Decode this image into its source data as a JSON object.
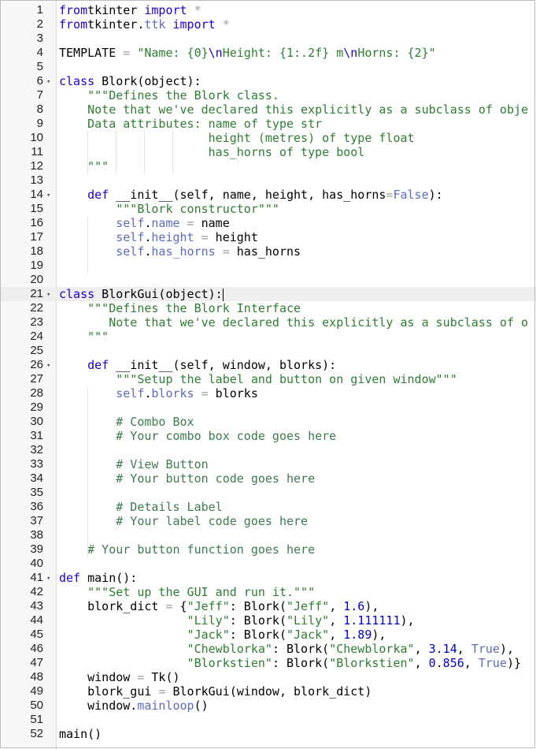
{
  "editor": {
    "language": "python",
    "active_line": 21,
    "cursor": {
      "line": 21,
      "after_text": "class BlorkGui(object):"
    },
    "colors": {
      "keyword": "#1c00cf",
      "string": "#2e7d32",
      "comment": "#3d7a4d",
      "number": "#0000cc",
      "property": "#5c6bc0",
      "operator": "#9e9e9e",
      "gutter_bg": "#f7f7f7",
      "active_line_bg": "#eeeeee"
    },
    "lines": [
      {
        "n": "1",
        "fold": false,
        "segs": [
          [
            "kw",
            "from"
          ],
          [
            "",
            "tkinter "
          ],
          [
            "kw",
            "import"
          ],
          [
            "op",
            " *"
          ]
        ]
      },
      {
        "n": "2",
        "fold": false,
        "segs": [
          [
            "kw",
            "from"
          ],
          [
            "",
            "tkinter."
          ],
          [
            "prop",
            "ttk"
          ],
          [
            "kw",
            " import"
          ],
          [
            "op",
            " *"
          ]
        ]
      },
      {
        "n": "3",
        "fold": false,
        "segs": []
      },
      {
        "n": "4",
        "fold": false,
        "segs": [
          [
            "",
            "TEMPLATE "
          ],
          [
            "op",
            "="
          ],
          [
            "str",
            " \"Name: {0}"
          ],
          [
            "kw",
            "\\n"
          ],
          [
            "str",
            "Height: {1:.2f} m"
          ],
          [
            "kw",
            "\\n"
          ],
          [
            "str",
            "Horns: {2}\""
          ]
        ]
      },
      {
        "n": "5",
        "fold": false,
        "segs": []
      },
      {
        "n": "6",
        "fold": true,
        "segs": [
          [
            "kw",
            "class"
          ],
          [
            "",
            " Blork(object):"
          ]
        ]
      },
      {
        "n": "7",
        "fold": false,
        "segs": [
          [
            "str",
            "    \"\"\"Defines the Blork class."
          ]
        ]
      },
      {
        "n": "8",
        "fold": false,
        "segs": [
          [
            "str",
            "    Note that we've declared this explicitly as a subclass of obje"
          ]
        ]
      },
      {
        "n": "9",
        "fold": false,
        "segs": [
          [
            "str",
            "    Data attributes: name of type str"
          ]
        ]
      },
      {
        "n": "10",
        "fold": false,
        "segs": [
          [
            "str",
            "                     height (metres) of type float"
          ]
        ]
      },
      {
        "n": "11",
        "fold": false,
        "segs": [
          [
            "str",
            "                     has_horns of type bool"
          ]
        ]
      },
      {
        "n": "12",
        "fold": false,
        "segs": [
          [
            "str",
            "    \"\"\""
          ]
        ]
      },
      {
        "n": "13",
        "fold": false,
        "segs": []
      },
      {
        "n": "14",
        "fold": true,
        "segs": [
          [
            "kw",
            "    def"
          ],
          [
            "",
            " __init__(self, name, height, has_horns"
          ],
          [
            "op",
            "="
          ],
          [
            "prop",
            "False"
          ],
          [
            "",
            "):"
          ]
        ]
      },
      {
        "n": "15",
        "fold": false,
        "segs": [
          [
            "str",
            "        \"\"\"Blork constructor\"\"\""
          ]
        ]
      },
      {
        "n": "16",
        "fold": false,
        "segs": [
          [
            "prop",
            "        self"
          ],
          [
            "",
            "."
          ],
          [
            "prop",
            "name"
          ],
          [
            "op",
            " ="
          ],
          [
            "",
            " name"
          ]
        ]
      },
      {
        "n": "17",
        "fold": false,
        "segs": [
          [
            "prop",
            "        self"
          ],
          [
            "",
            "."
          ],
          [
            "prop",
            "height"
          ],
          [
            "op",
            " ="
          ],
          [
            "",
            " height"
          ]
        ]
      },
      {
        "n": "18",
        "fold": false,
        "segs": [
          [
            "prop",
            "        self"
          ],
          [
            "",
            "."
          ],
          [
            "prop",
            "has_horns"
          ],
          [
            "op",
            " ="
          ],
          [
            "",
            " has_horns"
          ]
        ]
      },
      {
        "n": "19",
        "fold": false,
        "segs": []
      },
      {
        "n": "20",
        "fold": false,
        "segs": []
      },
      {
        "n": "21",
        "fold": true,
        "segs": [
          [
            "kw",
            "class"
          ],
          [
            "",
            " BlorkGui(object):"
          ]
        ]
      },
      {
        "n": "22",
        "fold": false,
        "segs": [
          [
            "str",
            "    \"\"\"Defines the Blork Interface"
          ]
        ]
      },
      {
        "n": "23",
        "fold": false,
        "segs": [
          [
            "str",
            "       Note that we've declared this explicitly as a subclass of o"
          ]
        ]
      },
      {
        "n": "24",
        "fold": false,
        "segs": [
          [
            "str",
            "    \"\"\""
          ]
        ]
      },
      {
        "n": "25",
        "fold": false,
        "segs": []
      },
      {
        "n": "26",
        "fold": true,
        "segs": [
          [
            "kw",
            "    def"
          ],
          [
            "",
            " __init__(self, window, blorks):"
          ]
        ]
      },
      {
        "n": "27",
        "fold": false,
        "segs": [
          [
            "str",
            "        \"\"\"Setup the label and button on given window\"\"\""
          ]
        ]
      },
      {
        "n": "28",
        "fold": false,
        "segs": [
          [
            "prop",
            "        self"
          ],
          [
            "",
            "."
          ],
          [
            "prop",
            "blorks"
          ],
          [
            "op",
            " ="
          ],
          [
            "",
            " blorks"
          ]
        ]
      },
      {
        "n": "29",
        "fold": false,
        "segs": []
      },
      {
        "n": "30",
        "fold": false,
        "segs": [
          [
            "cmt",
            "        # Combo Box"
          ]
        ]
      },
      {
        "n": "31",
        "fold": false,
        "segs": [
          [
            "cmt",
            "        # Your combo box code goes here"
          ]
        ]
      },
      {
        "n": "32",
        "fold": false,
        "segs": []
      },
      {
        "n": "33",
        "fold": false,
        "segs": [
          [
            "cmt",
            "        # View Button"
          ]
        ]
      },
      {
        "n": "34",
        "fold": false,
        "segs": [
          [
            "cmt",
            "        # Your button code goes here"
          ]
        ]
      },
      {
        "n": "35",
        "fold": false,
        "segs": []
      },
      {
        "n": "36",
        "fold": false,
        "segs": [
          [
            "cmt",
            "        # Details Label"
          ]
        ]
      },
      {
        "n": "37",
        "fold": false,
        "segs": [
          [
            "cmt",
            "        # Your label code goes here"
          ]
        ]
      },
      {
        "n": "38",
        "fold": false,
        "segs": []
      },
      {
        "n": "39",
        "fold": false,
        "segs": [
          [
            "cmt",
            "    # Your button function goes here"
          ]
        ]
      },
      {
        "n": "40",
        "fold": false,
        "segs": []
      },
      {
        "n": "41",
        "fold": true,
        "segs": [
          [
            "kw",
            "def"
          ],
          [
            "",
            " main():"
          ]
        ]
      },
      {
        "n": "42",
        "fold": false,
        "segs": [
          [
            "str",
            "    \"\"\"Set up the GUI and run it.\"\"\""
          ]
        ]
      },
      {
        "n": "43",
        "fold": false,
        "segs": [
          [
            "",
            "    blork_dict "
          ],
          [
            "op",
            "="
          ],
          [
            "",
            " {"
          ],
          [
            "str",
            "\"Jeff\""
          ],
          [
            "",
            ": Blork("
          ],
          [
            "str",
            "\"Jeff\""
          ],
          [
            "",
            ", "
          ],
          [
            "num",
            "1.6"
          ],
          [
            "",
            "),"
          ]
        ]
      },
      {
        "n": "44",
        "fold": false,
        "segs": [
          [
            "str",
            "                  \"Lily\""
          ],
          [
            "",
            ": Blork("
          ],
          [
            "str",
            "\"Lily\""
          ],
          [
            "",
            ", "
          ],
          [
            "num",
            "1.111111"
          ],
          [
            "",
            "),"
          ]
        ]
      },
      {
        "n": "45",
        "fold": false,
        "segs": [
          [
            "str",
            "                  \"Jack\""
          ],
          [
            "",
            ": Blork("
          ],
          [
            "str",
            "\"Jack\""
          ],
          [
            "",
            ", "
          ],
          [
            "num",
            "1.89"
          ],
          [
            "",
            "),"
          ]
        ]
      },
      {
        "n": "46",
        "fold": false,
        "segs": [
          [
            "str",
            "                  \"Chewblorka\""
          ],
          [
            "",
            ": Blork("
          ],
          [
            "str",
            "\"Chewblorka\""
          ],
          [
            "",
            ", "
          ],
          [
            "num",
            "3.14"
          ],
          [
            "",
            ", "
          ],
          [
            "prop",
            "True"
          ],
          [
            "",
            "),"
          ]
        ]
      },
      {
        "n": "47",
        "fold": false,
        "segs": [
          [
            "str",
            "                  \"Blorkstien\""
          ],
          [
            "",
            ": Blork("
          ],
          [
            "str",
            "\"Blorkstien\""
          ],
          [
            "",
            ", "
          ],
          [
            "num",
            "0.856"
          ],
          [
            "",
            ", "
          ],
          [
            "prop",
            "True"
          ],
          [
            "",
            ")}"
          ]
        ]
      },
      {
        "n": "48",
        "fold": false,
        "segs": [
          [
            "",
            "    window "
          ],
          [
            "op",
            "="
          ],
          [
            "",
            " Tk()"
          ]
        ]
      },
      {
        "n": "49",
        "fold": false,
        "segs": [
          [
            "",
            "    blork_gui "
          ],
          [
            "op",
            "="
          ],
          [
            "",
            " BlorkGui(window, blork_dict)"
          ]
        ]
      },
      {
        "n": "50",
        "fold": false,
        "segs": [
          [
            "",
            "    window."
          ],
          [
            "prop",
            "mainloop"
          ],
          [
            "",
            "()"
          ]
        ]
      },
      {
        "n": "51",
        "fold": false,
        "segs": []
      },
      {
        "n": "52",
        "fold": false,
        "segs": [
          [
            "",
            "main()"
          ]
        ]
      }
    ]
  }
}
